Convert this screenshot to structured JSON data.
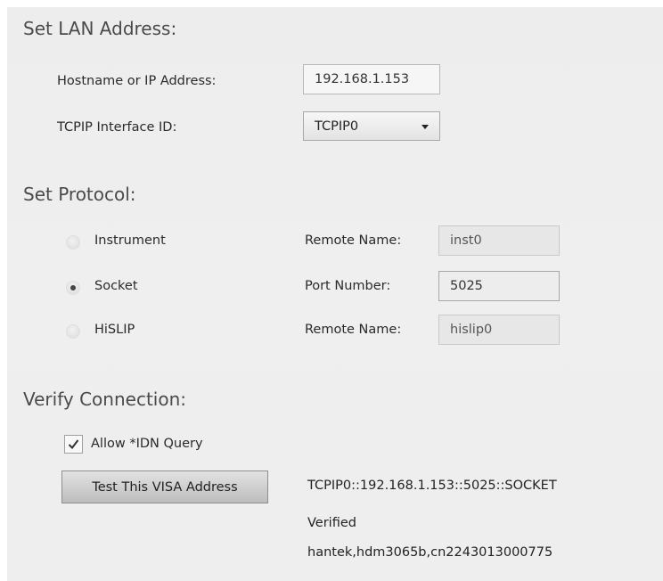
{
  "lan": {
    "title": "Set LAN Address:",
    "hostname_label": "Hostname or IP Address:",
    "hostname_value": "192.168.1.153",
    "interface_label": "TCPIP Interface ID:",
    "interface_value": "TCPIP0"
  },
  "protocol": {
    "title": "Set Protocol:",
    "options": [
      {
        "label": "Instrument",
        "selected": false,
        "field_label": "Remote Name:",
        "field_value": "inst0"
      },
      {
        "label": "Socket",
        "selected": true,
        "field_label": "Port Number:",
        "field_value": "5025"
      },
      {
        "label": "HiSLIP",
        "selected": false,
        "field_label": "Remote Name:",
        "field_value": "hislip0"
      }
    ]
  },
  "verify": {
    "title": "Verify Connection:",
    "idn_label": "Allow *IDN Query",
    "idn_checked": true,
    "test_button": "Test This VISA Address",
    "visa_address": "TCPIP0::192.168.1.153::5025::SOCKET",
    "status": "Verified",
    "idn_response": "hantek,hdm3065b,cn2243013000775"
  }
}
